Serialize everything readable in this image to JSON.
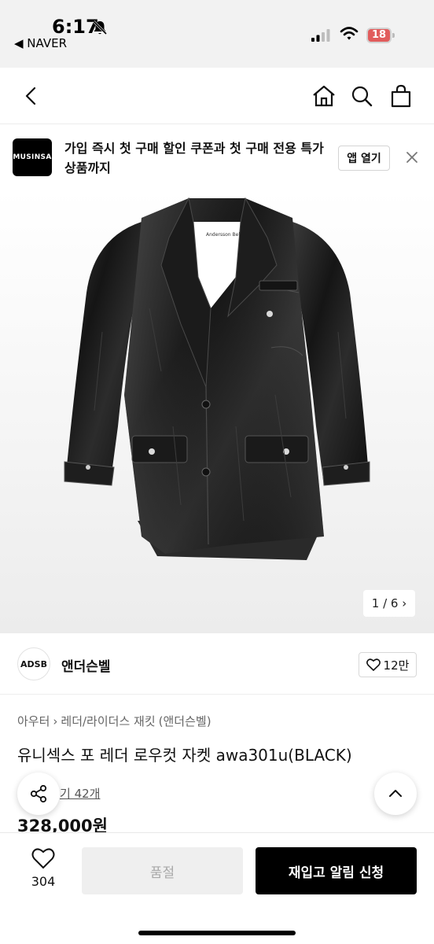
{
  "status_bar": {
    "time": "6:17",
    "back_app": "◀ NAVER",
    "battery": "18",
    "bell_icon": "bell-muted-icon"
  },
  "header": {
    "icons": [
      "back-icon",
      "home-icon",
      "search-icon",
      "shopping-bag-icon"
    ]
  },
  "banner": {
    "logo_text": "MUSINSA",
    "text": "가입 즉시 첫 구매 할인 쿠폰과 첫 구매 전용 특가 상품까지",
    "open_app": "앱 열기",
    "close_icon": "close-icon"
  },
  "product_image": {
    "tag_text": "Andersson Bell",
    "counter": "1 / 6 ›"
  },
  "brand": {
    "logo_text": "ADSB",
    "name": "앤더슨벨",
    "likes": "12만"
  },
  "breadcrumb": [
    "아우터",
    "›",
    "레더/라이더스 재킷",
    "(앤더슨벨)"
  ],
  "product": {
    "title": "유니섹스 포 레더 로우컷 자켓 awa301u(BLACK)",
    "review": "기 42개",
    "price": "328,000원"
  },
  "bottom_bar": {
    "wish_count": "304",
    "soldout_label": "품절",
    "restock_label": "재입고 알림 신청"
  },
  "colors": {
    "accent": "#000000",
    "battery_low": "#e15c5c",
    "disabled_bg": "#efefef"
  }
}
